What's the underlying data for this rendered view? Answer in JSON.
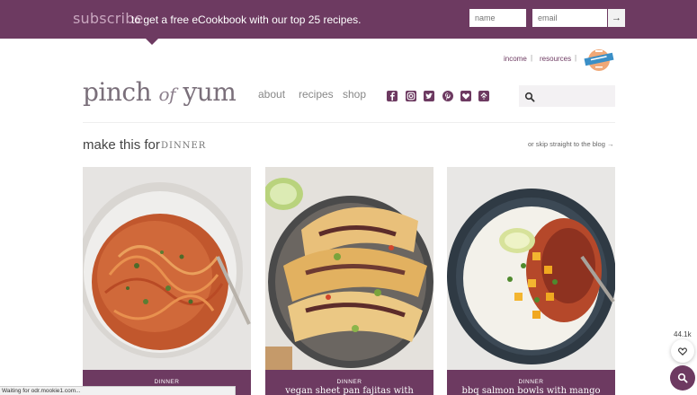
{
  "subscribe": {
    "word": "subscribe",
    "text": "to get a free eCookbook with our top 25 recipes.",
    "name_placeholder": "name",
    "email_placeholder": "email",
    "submit_glyph": "→"
  },
  "top_links": {
    "income": "income",
    "resources": "resources",
    "separator": "|"
  },
  "logo": {
    "left": "pinch",
    "of": "of",
    "right": "yum"
  },
  "nav": {
    "about": "about",
    "recipes": "recipes",
    "shop": "shop"
  },
  "social_icons": [
    "facebook-icon",
    "instagram-icon",
    "twitter-icon",
    "pinterest-icon",
    "bloglovin-icon",
    "feedly-icon"
  ],
  "section": {
    "title": "make this for",
    "category": "DINNER",
    "skip_link": "or skip straight to the blog →"
  },
  "cards": [
    {
      "category": "DINNER",
      "title": ""
    },
    {
      "category": "DINNER",
      "title": "vegan sheet pan fajitas with"
    },
    {
      "category": "DINNER",
      "title": "bbq salmon bowls with mango"
    }
  ],
  "share": {
    "count": "44.1k"
  },
  "status": {
    "text": "Waiting for odr.mookie1.com..."
  },
  "colors": {
    "brand_plum": "#6d3a61",
    "subscribe_word": "#c9a6bf"
  }
}
